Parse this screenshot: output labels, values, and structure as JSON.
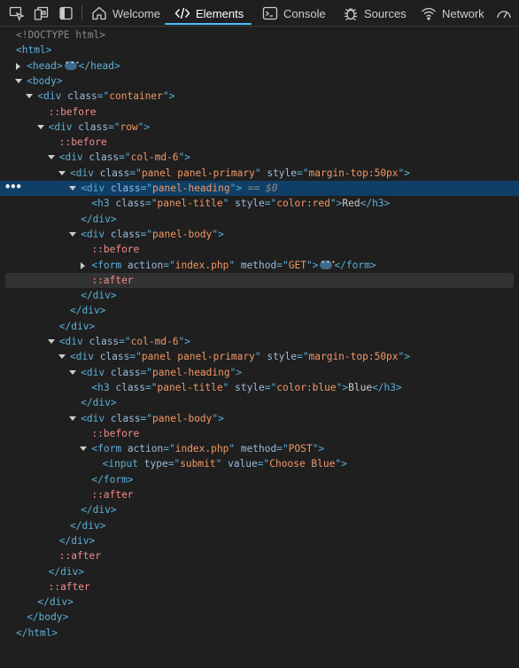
{
  "toolbar": {
    "icons": [
      "inspect-element-icon",
      "device-emulation-icon",
      "dock-sidebar-icon"
    ],
    "tabs": [
      {
        "label": "Welcome",
        "icon": "home-icon"
      },
      {
        "label": "Elements",
        "icon": "code-brackets-icon",
        "active": true
      },
      {
        "label": "Console",
        "icon": "console-icon"
      },
      {
        "label": "Sources",
        "icon": "bug-icon"
      },
      {
        "label": "Network",
        "icon": "wifi-icon"
      },
      {
        "label": "",
        "icon": "performance-gauge-icon"
      }
    ]
  },
  "colors": {
    "tag": "#5db0d7",
    "attr_name": "#9bbbdc",
    "attr_value": "#f29766",
    "pseudo": "#f28b8b",
    "selection": "#0f3f66",
    "accent": "#4cc2ff"
  },
  "tree": {
    "selected_marker": "== $0",
    "lines": [
      {
        "indent": 0,
        "t": [
          [
            "doctype",
            "<!DOCTYPE html>"
          ]
        ]
      },
      {
        "indent": 0,
        "t": [
          [
            "tag",
            "<html>"
          ]
        ]
      },
      {
        "indent": 1,
        "tw": "closed",
        "t": [
          [
            "tag",
            "<head>"
          ],
          [
            "ell",
            ""
          ],
          [
            "tag",
            "</head>"
          ]
        ]
      },
      {
        "indent": 1,
        "tw": "open",
        "t": [
          [
            "tag",
            "<body>"
          ]
        ]
      },
      {
        "indent": 2,
        "tw": "open",
        "t": [
          [
            "tag",
            "<div "
          ],
          [
            "attr",
            "class"
          ],
          [
            "tag",
            "=\""
          ],
          [
            "val",
            "container"
          ],
          [
            "tag",
            "\">"
          ]
        ]
      },
      {
        "indent": 3,
        "t": [
          [
            "pseudo",
            "::before"
          ]
        ]
      },
      {
        "indent": 3,
        "tw": "open",
        "t": [
          [
            "tag",
            "<div "
          ],
          [
            "attr",
            "class"
          ],
          [
            "tag",
            "=\""
          ],
          [
            "val",
            "row"
          ],
          [
            "tag",
            "\">"
          ]
        ]
      },
      {
        "indent": 4,
        "t": [
          [
            "pseudo",
            "::before"
          ]
        ]
      },
      {
        "indent": 4,
        "tw": "open",
        "t": [
          [
            "tag",
            "<div "
          ],
          [
            "attr",
            "class"
          ],
          [
            "tag",
            "=\""
          ],
          [
            "val",
            "col-md-6"
          ],
          [
            "tag",
            "\">"
          ]
        ]
      },
      {
        "indent": 5,
        "tw": "open",
        "t": [
          [
            "tag",
            "<div "
          ],
          [
            "attr",
            "class"
          ],
          [
            "tag",
            "=\""
          ],
          [
            "val",
            "panel panel-primary"
          ],
          [
            "tag",
            "\" "
          ],
          [
            "attr",
            "style"
          ],
          [
            "tag",
            "=\""
          ],
          [
            "val",
            "margin-top:50px"
          ],
          [
            "tag",
            "\">"
          ]
        ]
      },
      {
        "indent": 6,
        "tw": "open",
        "selected": true,
        "t": [
          [
            "tag",
            "<div "
          ],
          [
            "attr",
            "class"
          ],
          [
            "tag",
            "=\""
          ],
          [
            "val",
            "panel-heading"
          ],
          [
            "tag",
            "\">"
          ],
          [
            "eq0",
            " == $0"
          ]
        ]
      },
      {
        "indent": 7,
        "t": [
          [
            "tag",
            "<h3 "
          ],
          [
            "attr",
            "class"
          ],
          [
            "tag",
            "=\""
          ],
          [
            "val",
            "panel-title"
          ],
          [
            "tag",
            "\" "
          ],
          [
            "attr",
            "style"
          ],
          [
            "tag",
            "=\""
          ],
          [
            "val",
            "color:red"
          ],
          [
            "tag",
            "\">"
          ],
          [
            "txt",
            "Red"
          ],
          [
            "tag",
            "</h3>"
          ]
        ]
      },
      {
        "indent": 6,
        "t": [
          [
            "tag",
            "</div>"
          ]
        ]
      },
      {
        "indent": 6,
        "tw": "open",
        "t": [
          [
            "tag",
            "<div "
          ],
          [
            "attr",
            "class"
          ],
          [
            "tag",
            "=\""
          ],
          [
            "val",
            "panel-body"
          ],
          [
            "tag",
            "\">"
          ]
        ]
      },
      {
        "indent": 7,
        "t": [
          [
            "pseudo",
            "::before"
          ]
        ]
      },
      {
        "indent": 7,
        "tw": "closed",
        "t": [
          [
            "tag",
            "<form "
          ],
          [
            "attr",
            "action"
          ],
          [
            "tag",
            "=\""
          ],
          [
            "val",
            "index.php"
          ],
          [
            "tag",
            "\" "
          ],
          [
            "attr",
            "method"
          ],
          [
            "tag",
            "=\""
          ],
          [
            "val",
            "GET"
          ],
          [
            "tag",
            "\">"
          ],
          [
            "ell",
            ""
          ],
          [
            "tag",
            "</form>"
          ]
        ]
      },
      {
        "indent": 7,
        "hovered": true,
        "t": [
          [
            "pseudo",
            "::after"
          ]
        ]
      },
      {
        "indent": 6,
        "t": [
          [
            "tag",
            "</div>"
          ]
        ]
      },
      {
        "indent": 5,
        "t": [
          [
            "tag",
            "</div>"
          ]
        ]
      },
      {
        "indent": 4,
        "t": [
          [
            "tag",
            "</div>"
          ]
        ]
      },
      {
        "indent": 4,
        "tw": "open",
        "t": [
          [
            "tag",
            "<div "
          ],
          [
            "attr",
            "class"
          ],
          [
            "tag",
            "=\""
          ],
          [
            "val",
            "col-md-6"
          ],
          [
            "tag",
            "\">"
          ]
        ]
      },
      {
        "indent": 5,
        "tw": "open",
        "t": [
          [
            "tag",
            "<div "
          ],
          [
            "attr",
            "class"
          ],
          [
            "tag",
            "=\""
          ],
          [
            "val",
            "panel panel-primary"
          ],
          [
            "tag",
            "\" "
          ],
          [
            "attr",
            "style"
          ],
          [
            "tag",
            "=\""
          ],
          [
            "val",
            "margin-top:50px"
          ],
          [
            "tag",
            "\">"
          ]
        ]
      },
      {
        "indent": 6,
        "tw": "open",
        "t": [
          [
            "tag",
            "<div "
          ],
          [
            "attr",
            "class"
          ],
          [
            "tag",
            "=\""
          ],
          [
            "val",
            "panel-heading"
          ],
          [
            "tag",
            "\">"
          ]
        ]
      },
      {
        "indent": 7,
        "t": [
          [
            "tag",
            "<h3 "
          ],
          [
            "attr",
            "class"
          ],
          [
            "tag",
            "=\""
          ],
          [
            "val",
            "panel-title"
          ],
          [
            "tag",
            "\" "
          ],
          [
            "attr",
            "style"
          ],
          [
            "tag",
            "=\""
          ],
          [
            "val",
            "color:blue"
          ],
          [
            "tag",
            "\">"
          ],
          [
            "txt",
            "Blue"
          ],
          [
            "tag",
            "</h3>"
          ]
        ]
      },
      {
        "indent": 6,
        "t": [
          [
            "tag",
            "</div>"
          ]
        ]
      },
      {
        "indent": 6,
        "tw": "open",
        "t": [
          [
            "tag",
            "<div "
          ],
          [
            "attr",
            "class"
          ],
          [
            "tag",
            "=\""
          ],
          [
            "val",
            "panel-body"
          ],
          [
            "tag",
            "\">"
          ]
        ]
      },
      {
        "indent": 7,
        "t": [
          [
            "pseudo",
            "::before"
          ]
        ]
      },
      {
        "indent": 7,
        "tw": "open",
        "t": [
          [
            "tag",
            "<form "
          ],
          [
            "attr",
            "action"
          ],
          [
            "tag",
            "=\""
          ],
          [
            "val",
            "index.php"
          ],
          [
            "tag",
            "\" "
          ],
          [
            "attr",
            "method"
          ],
          [
            "tag",
            "=\""
          ],
          [
            "val",
            "POST"
          ],
          [
            "tag",
            "\">"
          ]
        ]
      },
      {
        "indent": 8,
        "t": [
          [
            "tag",
            "<input "
          ],
          [
            "attr",
            "type"
          ],
          [
            "tag",
            "=\""
          ],
          [
            "val",
            "submit"
          ],
          [
            "tag",
            "\" "
          ],
          [
            "attr",
            "value"
          ],
          [
            "tag",
            "=\""
          ],
          [
            "val",
            "Choose Blue"
          ],
          [
            "tag",
            "\">"
          ]
        ]
      },
      {
        "indent": 7,
        "t": [
          [
            "tag",
            "</form>"
          ]
        ]
      },
      {
        "indent": 7,
        "t": [
          [
            "pseudo",
            "::after"
          ]
        ]
      },
      {
        "indent": 6,
        "t": [
          [
            "tag",
            "</div>"
          ]
        ]
      },
      {
        "indent": 5,
        "t": [
          [
            "tag",
            "</div>"
          ]
        ]
      },
      {
        "indent": 4,
        "t": [
          [
            "tag",
            "</div>"
          ]
        ]
      },
      {
        "indent": 4,
        "t": [
          [
            "pseudo",
            "::after"
          ]
        ]
      },
      {
        "indent": 3,
        "t": [
          [
            "tag",
            "</div>"
          ]
        ]
      },
      {
        "indent": 3,
        "t": [
          [
            "pseudo",
            "::after"
          ]
        ]
      },
      {
        "indent": 2,
        "t": [
          [
            "tag",
            "</div>"
          ]
        ]
      },
      {
        "indent": 1,
        "t": [
          [
            "tag",
            "</body>"
          ]
        ]
      },
      {
        "indent": 0,
        "t": [
          [
            "tag",
            "</html>"
          ]
        ]
      }
    ]
  }
}
